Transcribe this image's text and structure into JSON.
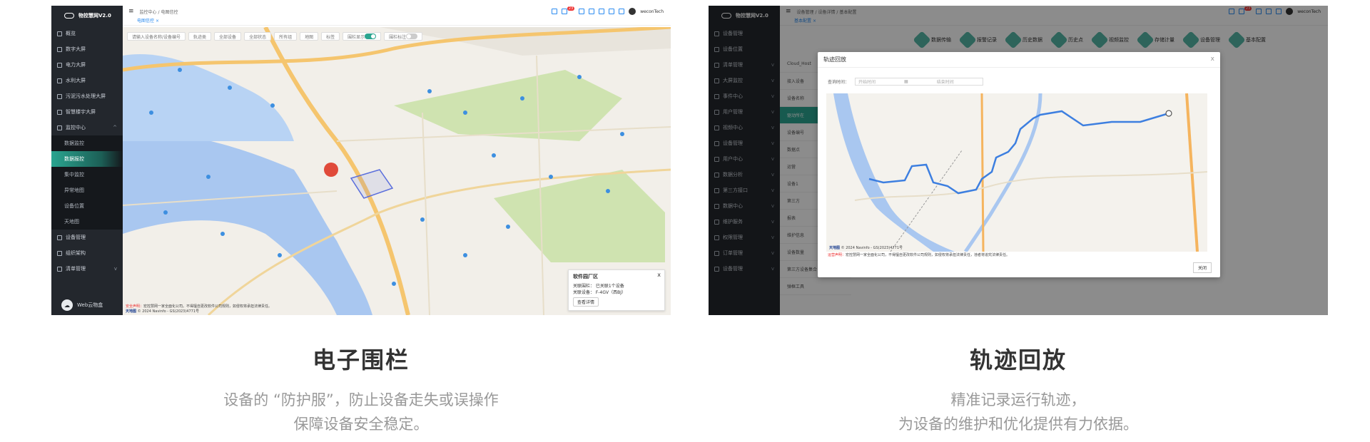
{
  "left_panel": {
    "app_title": "物控慧网V2.0",
    "breadcrumb": [
      "监控中心",
      "/",
      "电图信控"
    ],
    "open_tag": "电图信控",
    "header_user": "weconTech",
    "notif_badge": "23",
    "nav": [
      {
        "label": "概览",
        "chev": ""
      },
      {
        "label": "数字大屏",
        "chev": ""
      },
      {
        "label": "电力大屏",
        "chev": ""
      },
      {
        "label": "水利大屏",
        "chev": ""
      },
      {
        "label": "污泥污水处理大屏",
        "chev": ""
      },
      {
        "label": "智慧楼宇大屏",
        "chev": ""
      },
      {
        "label": "监控中心",
        "chev": "^"
      }
    ],
    "sub_nav": [
      "数据监控",
      "数据报控",
      "集中监控",
      "异常地图",
      "设备位置",
      "天地图"
    ],
    "active_sub": "数据报控",
    "nav_bottom": [
      {
        "label": "设备管理",
        "chev": ""
      },
      {
        "label": "组织架构",
        "chev": ""
      },
      {
        "label": "清单管理",
        "chev": "v"
      }
    ],
    "user": "Web云物盒",
    "filters": [
      "请输入设备名称/设备编号",
      "轨迹类",
      "全部设备",
      "全部状态",
      "所有组",
      "地图",
      "标签"
    ],
    "toggle_label_1": "围栏显示",
    "toggle_label_2": "围栏标注",
    "info_card": {
      "title": "软件园厂区",
      "rows": [
        "关联围栏：  已关联1个设备",
        "关联设备：  F-4GV（西BJ）"
      ],
      "button": "查看详情",
      "close": "x"
    },
    "footer_warn": "安全声明：",
    "footer_text": "宏控慧网一家全面化公司。不得擅自更改软件公司规则，如侵权将承担法律责任。",
    "footer_brand": "天地图",
    "footer_copy": "© 2024 Navinfo - GS(2023)4771号",
    "colors": {
      "sidebar": "#23272d",
      "accent": "#2aa590",
      "water": "#a9c7f0",
      "road": "#f5c56e",
      "park": "#cfe3b0",
      "track": "#3d7fe0"
    }
  },
  "right_panel": {
    "app_title": "物控慧网V2.0",
    "breadcrumb": [
      "设备管理",
      "/",
      "设备详情",
      "/",
      "基本配置"
    ],
    "open_tag": "基本配置",
    "header_user": "weconTech",
    "notif_badge": "23",
    "nav": [
      "设备管理",
      "设备位置",
      "清单管理",
      "大屏监控",
      "事件中心",
      "用户管理",
      "视频中心",
      "设备管理",
      "用户中心",
      "数据分析",
      "第三方接口",
      "数据中心",
      "维护服务",
      "权限管理",
      "订单管理",
      "设备管理"
    ],
    "modules": [
      "数据传输",
      "报警记录",
      "历史数据",
      "历史点",
      "视频监控",
      "存储计量",
      "设备管理",
      "基本配置"
    ],
    "list": [
      "Cloud_Host",
      "接入设备",
      "设备名称",
      "驱动所在",
      "设备编号",
      "数据点",
      "运营",
      "设备1",
      "第三方",
      "报表",
      "维护信息",
      "设备数量",
      "第三方设备集合",
      "弹框工具"
    ],
    "dialog": {
      "title": "轨迹回放",
      "close": "x",
      "query_label": "查询时间：",
      "start_placeholder": "开始时间",
      "end_placeholder": "结束时间",
      "footer_brand": "天地图",
      "footer_copy": "© 2024 Navinfo - GS(2023)4771号",
      "warn": "运营声明：",
      "note": "宏控慧网一家全面化公司，不得擅自更改软件公司规则，如侵权将承担法律责任，违者将追究法律责任。",
      "close_button": "关闭"
    }
  },
  "captions": [
    {
      "title": "电子围栏",
      "desc_1": "设备的 “防护服”，防止设备走失或误操作",
      "desc_2": "保障设备安全稳定。"
    },
    {
      "title": "轨迹回放",
      "desc_1": "精准记录运行轨迹，",
      "desc_2": "为设备的维护和优化提供有力依据。"
    }
  ]
}
